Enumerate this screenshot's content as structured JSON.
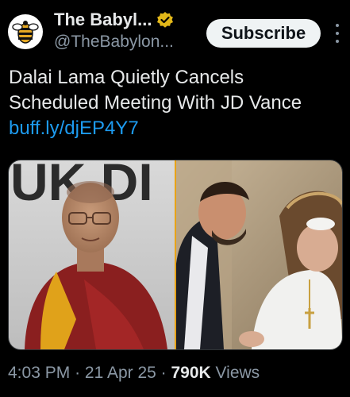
{
  "tweet": {
    "author": {
      "display_name": "The Babyl...",
      "handle": "@TheBabylon...",
      "verified_icon": "verified-badge-icon",
      "avatar_icon": "babylon-bee-logo-icon"
    },
    "subscribe_label": "Subscribe",
    "more_icon": "more-options-icon",
    "text": "Dalai Lama Quietly Cancels Scheduled Meeting With JD Vance ",
    "link": "buff.ly/djEP4Y7",
    "media": {
      "left_image_backdrop_text": "UK DI",
      "left_image": "dalai-lama-photo",
      "right_image": "vance-meeting-pope-photo"
    },
    "time": "4:03 PM",
    "separator": "·",
    "date": "21 Apr 25",
    "views_count": "790K",
    "views_label": "Views",
    "colors": {
      "background": "#000000",
      "text": "#e7e9ea",
      "secondary": "#8b98a5",
      "link": "#1d9bf0",
      "verified_gold": "#e2b719"
    }
  }
}
